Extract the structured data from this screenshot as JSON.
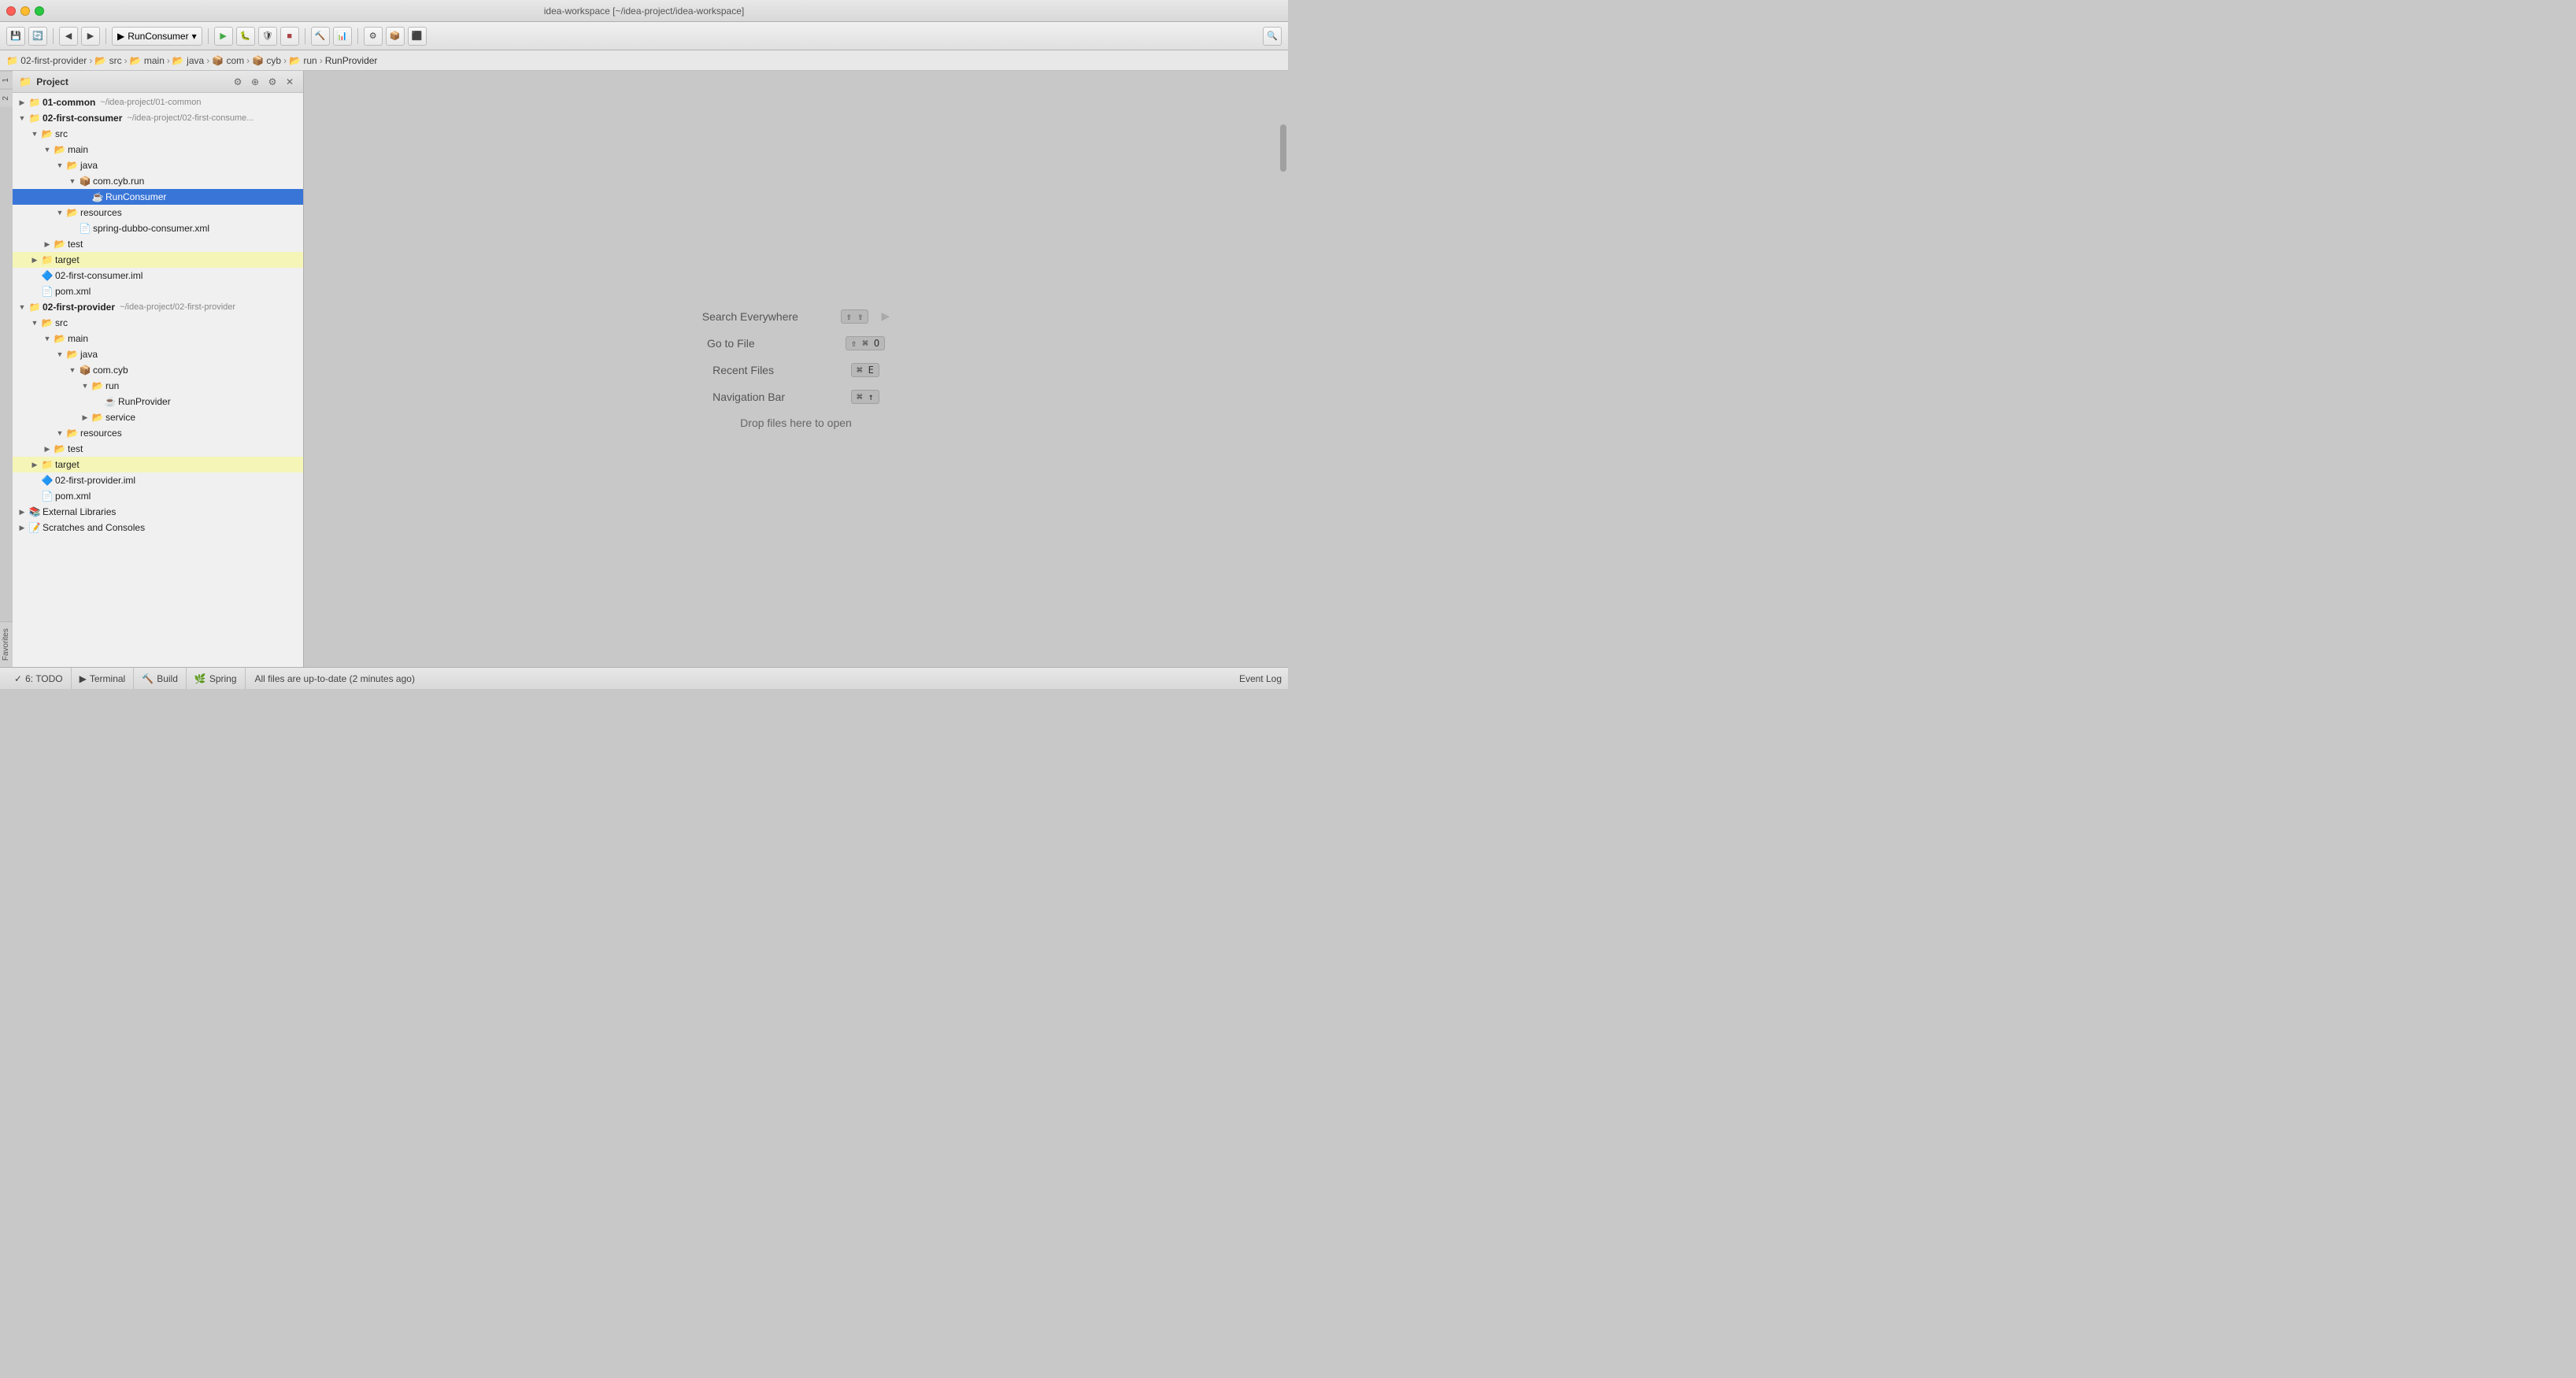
{
  "window": {
    "title": "idea-workspace [~/idea-project/idea-workspace]"
  },
  "titlebar": {
    "btn_close": "●",
    "btn_min": "●",
    "btn_max": "●"
  },
  "toolbar": {
    "run_config": "RunConsumer",
    "save_label": "💾",
    "buttons": [
      "save",
      "sync",
      "back",
      "forward",
      "run",
      "debug",
      "stop",
      "build",
      "coverage",
      "profile",
      "settings",
      "search"
    ]
  },
  "breadcrumb": {
    "items": [
      "02-first-provider",
      "src",
      "main",
      "java",
      "com",
      "cyb",
      "run",
      "RunProvider"
    ]
  },
  "panel": {
    "title": "Project",
    "tree": [
      {
        "indent": 0,
        "arrow": "▶",
        "icon": "📁",
        "label": "01-common",
        "path": "~/idea-project/01-common",
        "type": "module",
        "state": "collapsed"
      },
      {
        "indent": 0,
        "arrow": "▼",
        "icon": "📁",
        "label": "02-first-consumer",
        "path": "~/idea-project/02-first-consume...",
        "type": "module",
        "state": "expanded"
      },
      {
        "indent": 1,
        "arrow": "▼",
        "icon": "📂",
        "label": "src",
        "path": "",
        "type": "folder",
        "state": "expanded"
      },
      {
        "indent": 2,
        "arrow": "▼",
        "icon": "📂",
        "label": "main",
        "path": "",
        "type": "folder",
        "state": "expanded"
      },
      {
        "indent": 3,
        "arrow": "▼",
        "icon": "📂",
        "label": "java",
        "path": "",
        "type": "java",
        "state": "expanded"
      },
      {
        "indent": 4,
        "arrow": "▼",
        "icon": "📦",
        "label": "com.cyb.run",
        "path": "",
        "type": "package",
        "state": "expanded"
      },
      {
        "indent": 5,
        "arrow": "",
        "icon": "☕",
        "label": "RunConsumer",
        "path": "",
        "type": "class",
        "state": "leaf",
        "selected": true
      },
      {
        "indent": 3,
        "arrow": "▼",
        "icon": "📂",
        "label": "resources",
        "path": "",
        "type": "folder",
        "state": "expanded"
      },
      {
        "indent": 4,
        "arrow": "",
        "icon": "📄",
        "label": "spring-dubbo-consumer.xml",
        "path": "",
        "type": "xml",
        "state": "leaf"
      },
      {
        "indent": 2,
        "arrow": "▶",
        "icon": "📂",
        "label": "test",
        "path": "",
        "type": "folder",
        "state": "collapsed"
      },
      {
        "indent": 1,
        "arrow": "▶",
        "icon": "📁",
        "label": "target",
        "path": "",
        "type": "folder",
        "state": "collapsed",
        "highlighted": true
      },
      {
        "indent": 1,
        "arrow": "",
        "icon": "🔷",
        "label": "02-first-consumer.iml",
        "path": "",
        "type": "iml",
        "state": "leaf"
      },
      {
        "indent": 1,
        "arrow": "",
        "icon": "📄",
        "label": "pom.xml",
        "path": "",
        "type": "pom",
        "state": "leaf"
      },
      {
        "indent": 0,
        "arrow": "▼",
        "icon": "📁",
        "label": "02-first-provider",
        "path": "~/idea-project/02-first-provider",
        "type": "module",
        "state": "expanded"
      },
      {
        "indent": 1,
        "arrow": "▼",
        "icon": "📂",
        "label": "src",
        "path": "",
        "type": "folder",
        "state": "expanded"
      },
      {
        "indent": 2,
        "arrow": "▼",
        "icon": "📂",
        "label": "main",
        "path": "",
        "type": "folder",
        "state": "expanded"
      },
      {
        "indent": 3,
        "arrow": "▼",
        "icon": "📂",
        "label": "java",
        "path": "",
        "type": "java",
        "state": "expanded"
      },
      {
        "indent": 4,
        "arrow": "▼",
        "icon": "📦",
        "label": "com.cyb",
        "path": "",
        "type": "package",
        "state": "expanded"
      },
      {
        "indent": 5,
        "arrow": "▼",
        "icon": "📂",
        "label": "run",
        "path": "",
        "type": "folder",
        "state": "expanded"
      },
      {
        "indent": 6,
        "arrow": "",
        "icon": "☕",
        "label": "RunProvider",
        "path": "",
        "type": "class",
        "state": "leaf"
      },
      {
        "indent": 5,
        "arrow": "▶",
        "icon": "📂",
        "label": "service",
        "path": "",
        "type": "folder",
        "state": "collapsed"
      },
      {
        "indent": 3,
        "arrow": "▼",
        "icon": "📂",
        "label": "resources",
        "path": "",
        "type": "folder",
        "state": "expanded"
      },
      {
        "indent": 2,
        "arrow": "▶",
        "icon": "📂",
        "label": "test",
        "path": "",
        "type": "folder",
        "state": "collapsed"
      },
      {
        "indent": 1,
        "arrow": "▶",
        "icon": "📁",
        "label": "target",
        "path": "",
        "type": "folder",
        "state": "collapsed",
        "highlighted": true
      },
      {
        "indent": 1,
        "arrow": "",
        "icon": "🔷",
        "label": "02-first-provider.iml",
        "path": "",
        "type": "iml",
        "state": "leaf"
      },
      {
        "indent": 1,
        "arrow": "",
        "icon": "📄",
        "label": "pom.xml",
        "path": "",
        "type": "pom",
        "state": "leaf"
      },
      {
        "indent": 0,
        "arrow": "▶",
        "icon": "📚",
        "label": "External Libraries",
        "path": "",
        "type": "libs",
        "state": "collapsed"
      },
      {
        "indent": 0,
        "arrow": "▶",
        "icon": "📝",
        "label": "Scratches and Consoles",
        "path": "",
        "type": "scratches",
        "state": "collapsed"
      }
    ]
  },
  "main": {
    "shortcuts": [
      {
        "label": "Search Everywhere",
        "key": "⇧⇧"
      },
      {
        "label": "Go to File",
        "key": "⇧⌘O"
      },
      {
        "label": "Recent Files",
        "key": "⌘E"
      },
      {
        "label": "Navigation Bar",
        "key": "⌘↑"
      }
    ],
    "drop_text": "Drop files here to open"
  },
  "statusbar": {
    "tabs": [
      {
        "icon": "✓",
        "label": "6: TODO"
      },
      {
        "icon": "▶",
        "label": "Terminal"
      },
      {
        "icon": "🔨",
        "label": "Build"
      },
      {
        "icon": "🌿",
        "label": "Spring"
      }
    ],
    "message": "All files are up-to-date (2 minutes ago)",
    "event_log": "Event Log"
  }
}
